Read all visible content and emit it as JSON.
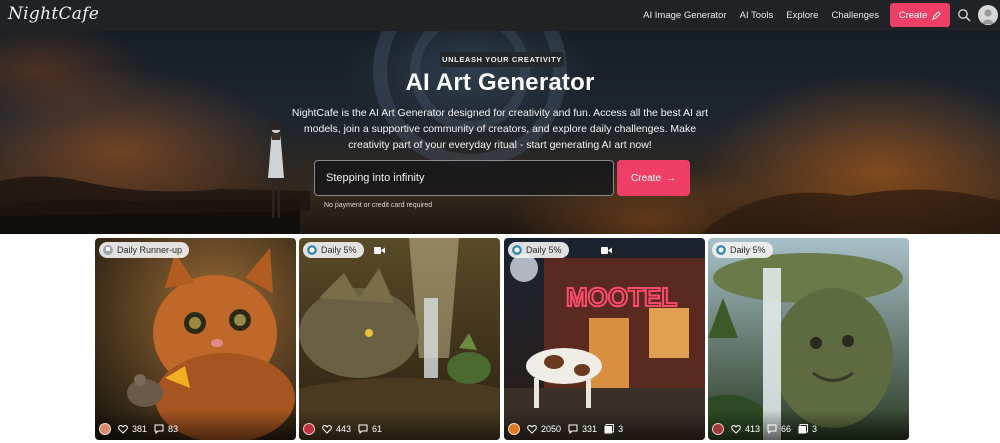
{
  "nav": {
    "logo": "NightCafe",
    "links": [
      "AI Image Generator",
      "AI Tools",
      "Explore",
      "Challenges"
    ],
    "create_label": "Create",
    "icons": [
      "pencil-icon",
      "search-icon",
      "avatar"
    ]
  },
  "hero": {
    "eyebrow": "UNLEASH YOUR CREATIVITY",
    "title": "AI Art Generator",
    "description": "NightCafe is the AI Art Generator designed for creativity and fun. Access all the best AI art models, join a supportive community of creators, and explore daily challenges. Make creativity part of your everyday ritual - start generating AI art now!",
    "input_value": "Stepping into infinity",
    "create_label": "Create",
    "arrow": "→",
    "note": "No payment or credit card required"
  },
  "cards": [
    {
      "badge": "Daily Runner-up",
      "badge_icon": "trophy-icon",
      "video": false,
      "likes": "381",
      "comments": "83",
      "images": null,
      "subject": "kitten-and-mouse"
    },
    {
      "badge": "Daily 5%",
      "badge_icon": "medal-icon",
      "video": true,
      "likes": "443",
      "comments": "61",
      "images": null,
      "subject": "dragon-waterfall"
    },
    {
      "badge": "Daily 5%",
      "badge_icon": "medal-icon",
      "video": true,
      "likes": "2050",
      "comments": "331",
      "images": "3",
      "subject": "motel-cow"
    },
    {
      "badge": "Daily 5%",
      "badge_icon": "medal-icon",
      "video": false,
      "likes": "413",
      "comments": "66",
      "images": "3",
      "subject": "troll-waterfall"
    }
  ],
  "colors": {
    "nav_bg": "#1f2326",
    "accent": "#ef3f66"
  }
}
